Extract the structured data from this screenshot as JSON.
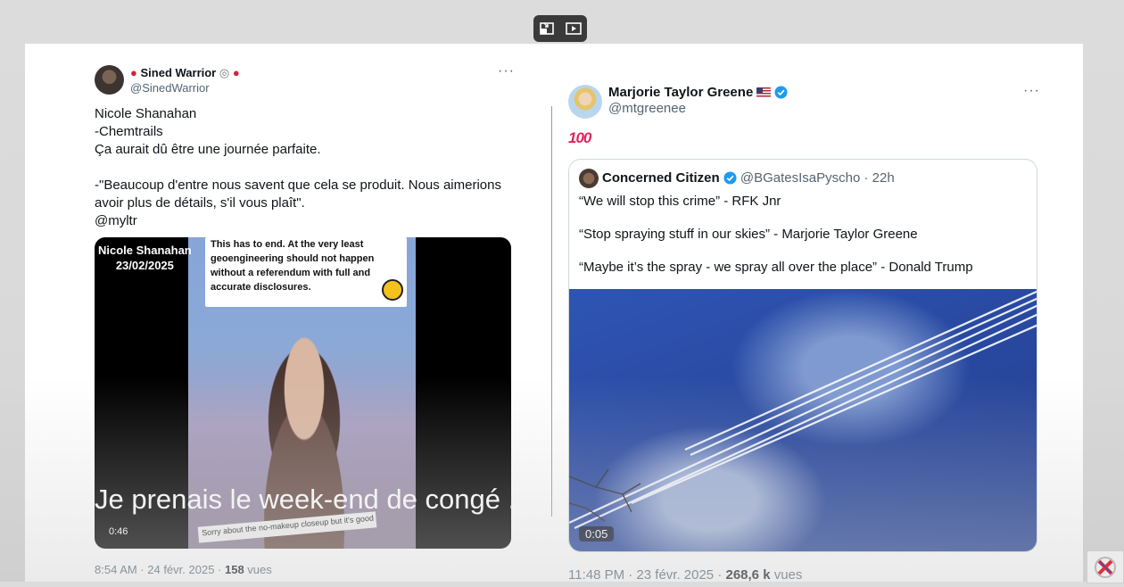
{
  "left_tweet": {
    "name": "Sined Warrior",
    "handle": "@SinedWarrior",
    "more": "···",
    "text": "Nicole Shanahan\n-Chemtrails\nÇa aurait dû être une journée parfaite.\n\n-\"Beaucoup d'entre nous savent que cela se produit. Nous aimerions avoir plus de détails, s'il vous plaît\".\n@myltr",
    "video": {
      "overlay_name": "Nicole Shanahan",
      "overlay_date": "23/02/2025",
      "banner": "This has to end. At the very least geoengineering should not happen without a referendum with full and accurate disclosures.",
      "caption": "Je prenais le week-end de congé ...",
      "tape": "Sorry about the no-makeup closeup but it's good",
      "duration": "0:46"
    },
    "footer": {
      "time": "8:54 AM · 24 févr. 2025 · ",
      "views_count": "158",
      "views_label": " vues"
    }
  },
  "right_tweet": {
    "name": "Marjorie Taylor Greene",
    "handle": "@mtgreenee",
    "more": "···",
    "emoji": "100",
    "quote": {
      "name": "Concerned Citizen",
      "handle": "@BGatesIsaPyscho",
      "age": "22h",
      "lines": [
        "“We will stop this crime” - RFK Jnr",
        "“Stop spraying stuff in our skies” - Marjorie Taylor Greene",
        "“Maybe it’s the spray - we spray all over the place” - Donald Trump"
      ],
      "duration": "0:05"
    },
    "footer": {
      "time": "11:48 PM · 23 févr. 2025 · ",
      "views_count": "268,6 k",
      "views_label": " vues"
    }
  },
  "colors": {
    "verified": "#1d9bf0",
    "muted": "#536471",
    "text": "#0f1419"
  }
}
